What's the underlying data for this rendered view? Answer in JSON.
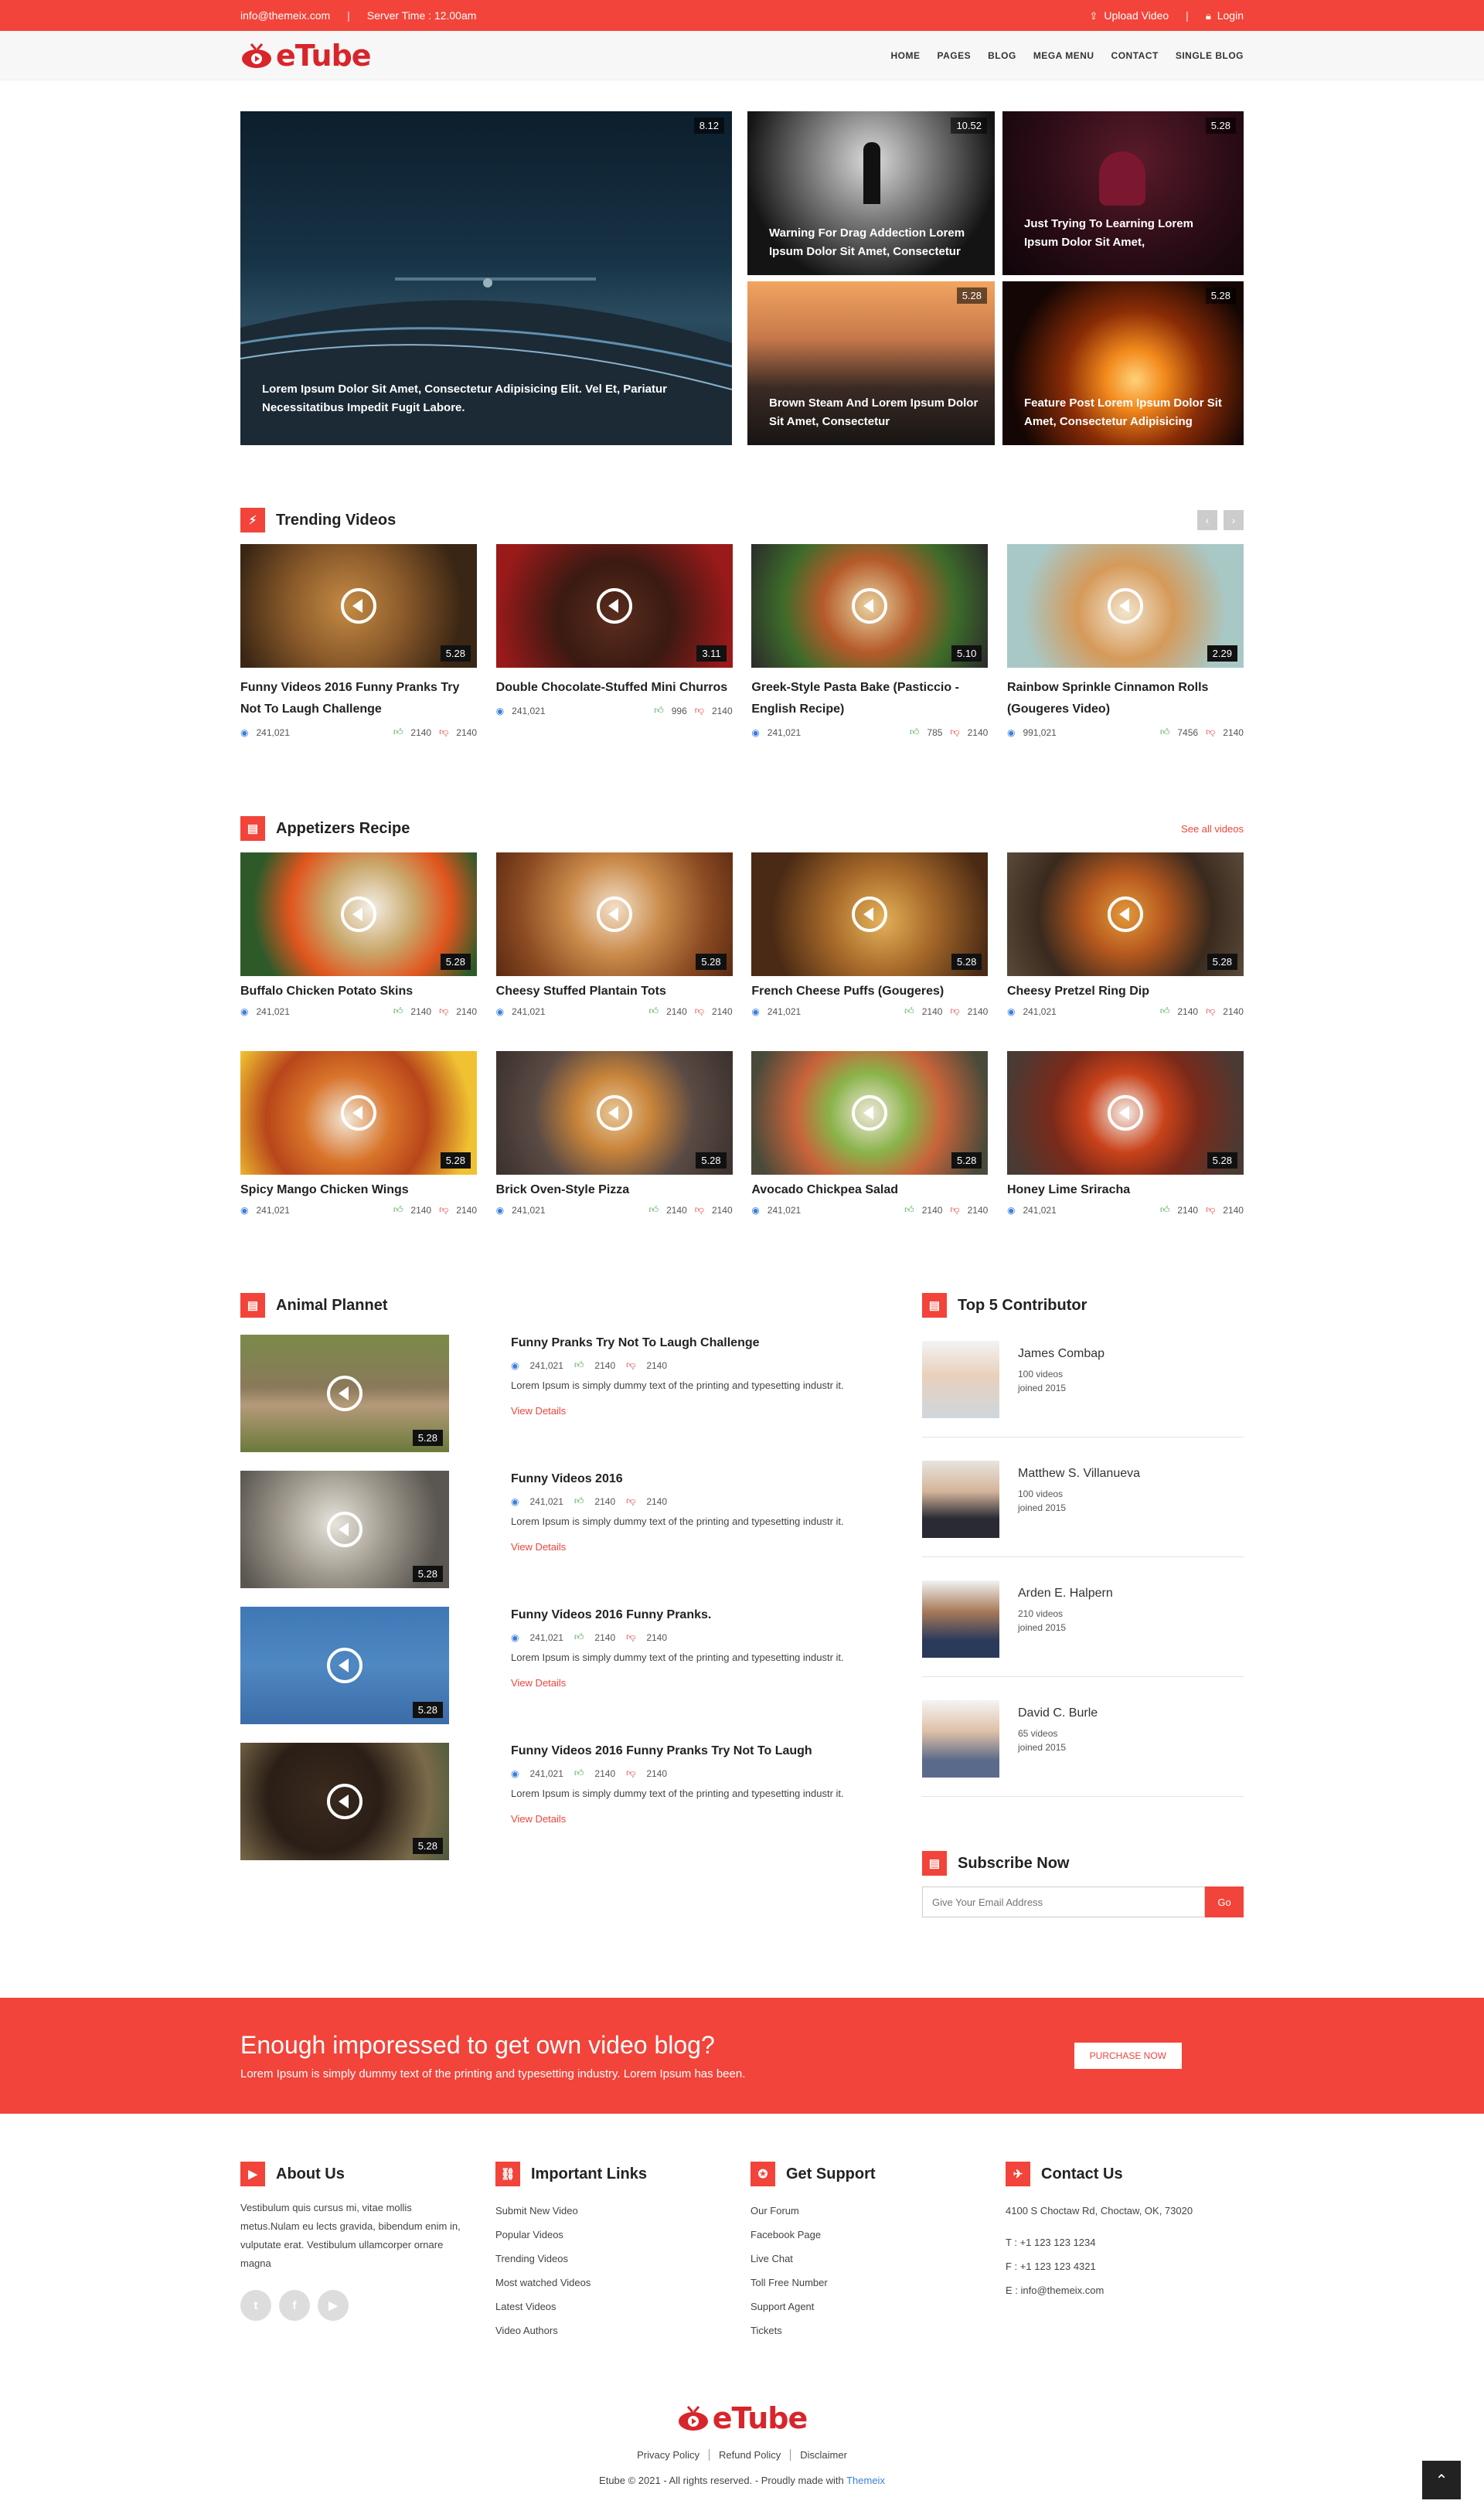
{
  "topbar": {
    "email": "info@themeix.com",
    "server_time": "Server Time : 12.00am",
    "upload": "Upload Video",
    "login": "Login"
  },
  "brand": {
    "name": "eTube",
    "accent": "#f2443a",
    "logo_red": "#d8252b"
  },
  "nav": [
    "HOME",
    "PAGES",
    "BLOG",
    "MEGA MENU",
    "CONTACT",
    "SINGLE BLOG"
  ],
  "hero": [
    {
      "badge": "8.12",
      "caption": "Lorem Ipsum Dolor Sit Amet, Consectetur Adipisicing Elit. Vel Et, Pariatur Necessitatibus Impedit Fugit Labore."
    },
    {
      "badge": "10.52",
      "caption": "Warning For Drag Addection Lorem Ipsum Dolor Sit Amet, Consectetur"
    },
    {
      "badge": "5.28",
      "caption": "Just Trying To Learning Lorem Ipsum Dolor Sit Amet,"
    },
    {
      "badge": "5.28",
      "caption": "Brown Steam And Lorem Ipsum Dolor Sit Amet, Consectetur"
    },
    {
      "badge": "5.28",
      "caption": "Feature Post Lorem Ipsum Dolor Sit Amet, Consectetur Adipisicing"
    }
  ],
  "trending": {
    "title": "Trending Videos",
    "prev": "‹",
    "next": "›",
    "items": [
      {
        "title": "Funny Videos 2016 Funny Pranks Try Not To Laugh Challenge",
        "duration": "5.28",
        "views": "241,021",
        "likes": "2140",
        "dislikes": "2140"
      },
      {
        "title": "Double Chocolate-Stuffed Mini Churros",
        "duration": "3.11",
        "views": "241,021",
        "likes": "996",
        "dislikes": "2140"
      },
      {
        "title": "Greek-Style Pasta Bake (Pasticcio - English Recipe)",
        "duration": "5.10",
        "views": "241,021",
        "likes": "785",
        "dislikes": "2140"
      },
      {
        "title": "Rainbow Sprinkle Cinnamon Rolls (Gougeres Video)",
        "duration": "2.29",
        "views": "991,021",
        "likes": "7456",
        "dislikes": "2140"
      }
    ]
  },
  "appetizers": {
    "title": "Appetizers Recipe",
    "see_all": "See all videos",
    "items": [
      {
        "title": "Buffalo Chicken Potato Skins",
        "duration": "5.28",
        "views": "241,021",
        "likes": "2140",
        "dislikes": "2140"
      },
      {
        "title": "Cheesy Stuffed Plantain Tots",
        "duration": "5.28",
        "views": "241,021",
        "likes": "2140",
        "dislikes": "2140"
      },
      {
        "title": "French Cheese Puffs (Gougeres)",
        "duration": "5.28",
        "views": "241,021",
        "likes": "2140",
        "dislikes": "2140"
      },
      {
        "title": "Cheesy Pretzel Ring Dip",
        "duration": "5.28",
        "views": "241,021",
        "likes": "2140",
        "dislikes": "2140"
      },
      {
        "title": "Spicy Mango Chicken Wings",
        "duration": "5.28",
        "views": "241,021",
        "likes": "2140",
        "dislikes": "2140"
      },
      {
        "title": "Brick Oven-Style Pizza",
        "duration": "5.28",
        "views": "241,021",
        "likes": "2140",
        "dislikes": "2140"
      },
      {
        "title": "Avocado Chickpea Salad",
        "duration": "5.28",
        "views": "241,021",
        "likes": "2140",
        "dislikes": "2140"
      },
      {
        "title": "Honey Lime Sriracha",
        "duration": "5.28",
        "views": "241,021",
        "likes": "2140",
        "dislikes": "2140"
      }
    ]
  },
  "animal": {
    "title": "Animal Plannet",
    "items": [
      {
        "title": "Funny Pranks Try Not To Laugh Challenge",
        "duration": "5.28",
        "views": "241,021",
        "likes": "2140",
        "dislikes": "2140",
        "desc": "Lorem Ipsum is simply dummy text of the printing and typesetting industr it.",
        "link": "View Details"
      },
      {
        "title": "Funny Videos 2016",
        "duration": "5.28",
        "views": "241,021",
        "likes": "2140",
        "dislikes": "2140",
        "desc": "Lorem Ipsum is simply dummy text of the printing and typesetting industr it.",
        "link": "View Details"
      },
      {
        "title": "Funny Videos 2016 Funny Pranks.",
        "duration": "5.28",
        "views": "241,021",
        "likes": "2140",
        "dislikes": "2140",
        "desc": "Lorem Ipsum is simply dummy text of the printing and typesetting industr it.",
        "link": "View Details"
      },
      {
        "title": "Funny Videos 2016 Funny Pranks Try Not To Laugh",
        "duration": "5.28",
        "views": "241,021",
        "likes": "2140",
        "dislikes": "2140",
        "desc": "Lorem Ipsum is simply dummy text of the printing and typesetting industr it.",
        "link": "View Details"
      }
    ]
  },
  "contributors": {
    "title": "Top 5 Contributor",
    "items": [
      {
        "name": "James Combap",
        "videos": "100 videos",
        "joined": "joined 2015"
      },
      {
        "name": "Matthew S. Villanueva",
        "videos": "100 videos",
        "joined": "joined 2015"
      },
      {
        "name": "Arden E. Halpern",
        "videos": "210 videos",
        "joined": "joined 2015"
      },
      {
        "name": "David C. Burle",
        "videos": "65 videos",
        "joined": "joined 2015"
      }
    ]
  },
  "subscribe": {
    "title": "Subscribe Now",
    "placeholder": "Give Your Email Address",
    "button": "Go"
  },
  "cta": {
    "heading": "Enough imporessed to get own video blog?",
    "text": "Lorem Ipsum is simply dummy text of the printing and typesetting industry. Lorem Ipsum has been.",
    "button": "PURCHASE NOW"
  },
  "footer": {
    "about": {
      "title": "About Us",
      "text": "Vestibulum quis cursus mi, vitae mollis metus.Nulam eu lects gravida, bibendum enim in, vulputate erat. Vestibulum ullamcorper ornare magna"
    },
    "links": {
      "title": "Important Links",
      "items": [
        "Submit New Video",
        "Popular Videos",
        "Trending Videos",
        "Most watched Videos",
        "Latest Videos",
        "Video Authors"
      ]
    },
    "support": {
      "title": "Get Support",
      "items": [
        "Our Forum",
        "Facebook Page",
        "Live Chat",
        "Toll Free Number",
        "Support Agent",
        "Tickets"
      ]
    },
    "contact": {
      "title": "Contact Us",
      "address": "4100 S Choctaw Rd, Choctaw, OK, 73020",
      "phone": "T : +1 123 123 1234",
      "fax": "F : +1 123 123 4321",
      "email": "E : info@themeix.com"
    },
    "bottom_links": [
      "Privacy Policy",
      "Refund Policy",
      "Disclaimer"
    ],
    "copyright": "Etube © 2021 - All rights reserved. - Proudly made with",
    "credit": "Themeix"
  }
}
